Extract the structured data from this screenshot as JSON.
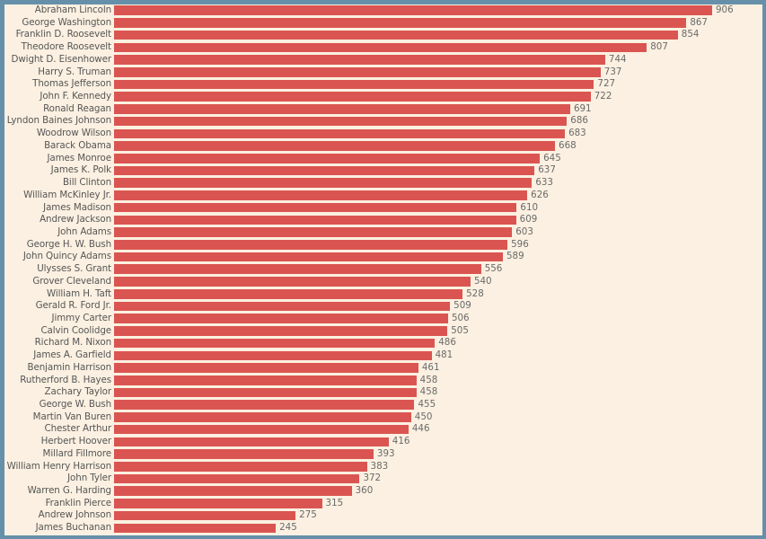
{
  "chart_data": {
    "type": "bar",
    "orientation": "horizontal",
    "title": "",
    "subtitle": "",
    "xlabel": "",
    "ylabel": "",
    "grid": false,
    "legend": null,
    "axis_visible": false,
    "value_labels_shown": true,
    "xlim": [
      0,
      906
    ],
    "bar_color": "#da5551",
    "background_color": "#fbf0e1",
    "frame_color": "#6690aa",
    "label_color": "#565656",
    "value_label_color": "#6a6a6a",
    "categories": [
      "Abraham Lincoln",
      "George Washington",
      "Franklin D. Roosevelt",
      "Theodore Roosevelt",
      "Dwight D. Eisenhower",
      "Harry S. Truman",
      "Thomas Jefferson",
      "John F. Kennedy",
      "Ronald Reagan",
      "Lyndon Baines Johnson",
      "Woodrow Wilson",
      "Barack Obama",
      "James Monroe",
      "James K. Polk",
      "Bill Clinton",
      "William McKinley Jr.",
      "James Madison",
      "Andrew Jackson",
      "John Adams",
      "George H. W. Bush",
      "John Quincy Adams",
      "Ulysses S. Grant",
      "Grover Cleveland",
      "William H. Taft",
      "Gerald R. Ford Jr.",
      "Jimmy Carter",
      "Calvin Coolidge",
      "Richard M. Nixon",
      "James A. Garfield",
      "Benjamin Harrison",
      "Rutherford B. Hayes",
      "Zachary Taylor",
      "George W. Bush",
      "Martin Van Buren",
      "Chester Arthur",
      "Herbert Hoover",
      "Millard Fillmore",
      "William Henry Harrison",
      "John Tyler",
      "Warren G. Harding",
      "Franklin Pierce",
      "Andrew Johnson",
      "James Buchanan"
    ],
    "values": [
      906,
      867,
      854,
      807,
      744,
      737,
      727,
      722,
      691,
      686,
      683,
      668,
      645,
      637,
      633,
      626,
      610,
      609,
      603,
      596,
      589,
      556,
      540,
      528,
      509,
      506,
      505,
      486,
      481,
      461,
      458,
      458,
      455,
      450,
      446,
      416,
      393,
      383,
      372,
      360,
      315,
      275,
      245
    ]
  }
}
